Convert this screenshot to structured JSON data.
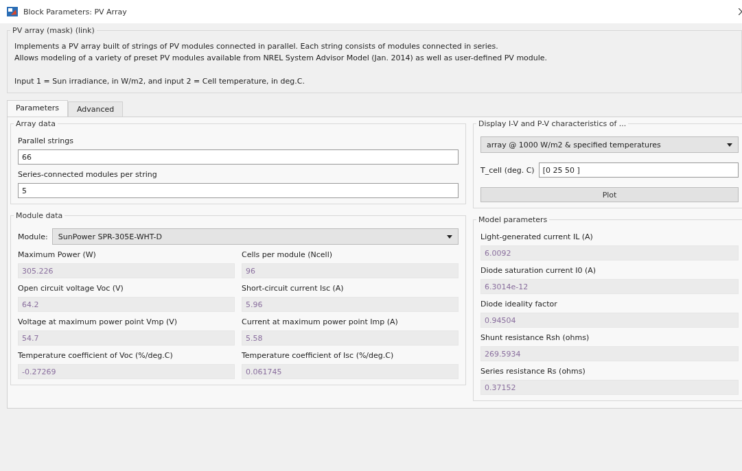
{
  "window": {
    "title": "Block Parameters: PV Array"
  },
  "mask": {
    "title": "PV array (mask) (link)",
    "description": [
      "Implements a PV array built of strings of PV modules connected in parallel. Each string consists of modules connected in series.",
      "Allows modeling of a variety of preset PV modules available from NREL System Advisor Model (Jan. 2014) as well as user-defined PV module."
    ],
    "note": "Input 1 = Sun irradiance, in W/m2, and input 2 = Cell temperature, in deg.C."
  },
  "tabs": [
    {
      "label": "Parameters",
      "selected": true
    },
    {
      "label": "Advanced",
      "selected": false
    }
  ],
  "array_data": {
    "title": "Array data",
    "fields": [
      {
        "label": "Parallel strings",
        "value": "66",
        "disabled": false
      },
      {
        "label": "Series-connected modules per string",
        "value": "5",
        "disabled": false
      }
    ]
  },
  "display": {
    "title": "Display  I-V and P-V characteristics of ...",
    "dropdown": "array @ 1000 W/m2 & specified temperatures",
    "tcell": {
      "label": "T_cell (deg. C)",
      "value": "[0 25 50  ]"
    },
    "button": "Plot"
  },
  "module_data": {
    "title": "Module data",
    "module": {
      "label": "Module:",
      "value": "SunPower SPR-305E-WHT-D"
    },
    "fields": [
      {
        "label": "Maximum Power (W)",
        "value": "305.226",
        "disabled": true
      },
      {
        "label": "Cells per module (Ncell)",
        "value": "96",
        "disabled": true
      },
      {
        "label": "Open circuit voltage  Voc (V)",
        "value": "64.2",
        "disabled": true
      },
      {
        "label": "Short-circuit current Isc (A)",
        "value": "5.96",
        "disabled": true
      },
      {
        "label": "Voltage at maximum power point Vmp (V)",
        "value": "54.7",
        "disabled": true
      },
      {
        "label": "Current at maximum power point Imp (A)",
        "value": "5.58",
        "disabled": true
      },
      {
        "label": "Temperature coefficient of Voc (%/deg.C)",
        "value": "-0.27269",
        "disabled": true
      },
      {
        "label": "Temperature coefficient of Isc (%/deg.C)",
        "value": "0.061745",
        "disabled": true
      }
    ]
  },
  "model_parameters": {
    "title": "Model parameters",
    "fields": [
      {
        "label": "Light-generated current IL (A)",
        "value": "6.0092",
        "disabled": true
      },
      {
        "label": "Diode saturation current I0 (A)",
        "value": "6.3014e-12",
        "disabled": true
      },
      {
        "label": "Diode ideality factor",
        "value": "0.94504",
        "disabled": true
      },
      {
        "label": "Shunt resistance Rsh (ohms)",
        "value": "269.5934",
        "disabled": true
      },
      {
        "label": "Series resistance Rs (ohms)",
        "value": "0.37152",
        "disabled": true
      }
    ]
  }
}
